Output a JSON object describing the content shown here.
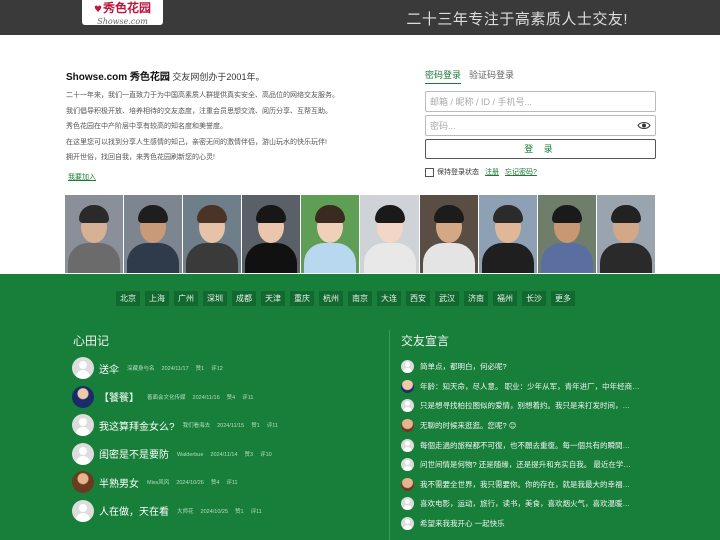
{
  "header": {
    "logo_main": "秀色花园",
    "logo_sub": "Showse.com",
    "slogan": "二十三年专注于高素质人士交友!"
  },
  "intro": {
    "brand": "Showse.com 秀色花园",
    "founded": "交友网创办于2001年。",
    "lines": [
      "二十一年来，我们一直致力于为中国高素质人群提供真实安全、高品位的网络交友服务。",
      "我们倡导积极开放、培养相待的交友态度，注重会员思想交流、阅历分享、互帮互助。",
      "秀色花园在中产阶层中享有较高的知名度和美誉度。",
      "在这里您可以找到分享人生感情的知己，亲密无间的激情伴侣，游山玩水的快乐玩伴!",
      "拥开世俗，找回自我，来秀色花园刷新您的心灵!"
    ],
    "join_link": "我要加入"
  },
  "login": {
    "tab_password": "密码登录",
    "tab_code": "验证码登录",
    "account_placeholder": "邮箱 / 昵称 / ID / 手机号...",
    "password_placeholder": "密码...",
    "submit_label": "登 录",
    "remember_label": "保持登录状态",
    "register_link": "注册",
    "forgot_link": "忘记密码?"
  },
  "photos": [
    {
      "bg": "#8a8f99",
      "skin": "#d6b196",
      "hair": "#2a2a2a",
      "body": "#6b6b6b"
    },
    {
      "bg": "#7c8590",
      "skin": "#c89a7a",
      "hair": "#1e1e1e",
      "body": "#2f3b4a"
    },
    {
      "bg": "#6e7f8a",
      "skin": "#e6c2a8",
      "hair": "#4a3428",
      "body": "#3a3a3a"
    },
    {
      "bg": "#5a5f68",
      "skin": "#e9c6ad",
      "hair": "#171717",
      "body": "#111111"
    },
    {
      "bg": "#5f9f55",
      "skin": "#f0d0b8",
      "hair": "#3a2a20",
      "body": "#b8d8f0"
    },
    {
      "bg": "#cfd3d8",
      "skin": "#f2d6c6",
      "hair": "#1a1a1a",
      "body": "#e8e8e8"
    },
    {
      "bg": "#5a4e44",
      "skin": "#d4a884",
      "hair": "#1c1c1c",
      "body": "#e4e4e4"
    },
    {
      "bg": "#8da0b4",
      "skin": "#e0b898",
      "hair": "#2b2b2b",
      "body": "#1f1f1f"
    },
    {
      "bg": "#6f7e6a",
      "skin": "#c89874",
      "hair": "#1a1a1a",
      "body": "#5a6fa0"
    },
    {
      "bg": "#9aa4ae",
      "skin": "#d2a888",
      "hair": "#222222",
      "body": "#2a2a2a"
    }
  ],
  "cities": [
    "北京",
    "上海",
    "广州",
    "深圳",
    "成都",
    "天津",
    "重庆",
    "杭州",
    "南京",
    "大连",
    "西安",
    "武汉",
    "济南",
    "福州",
    "长沙",
    "更多"
  ],
  "diary": {
    "title": "心田记",
    "items": [
      {
        "avatar": "generic",
        "text": "送伞",
        "author": "深藏身与名",
        "date": "2024/11/17",
        "likes": "赞1",
        "comments": "评12"
      },
      {
        "avatar": "photo1",
        "text": "【饕餮】",
        "author": "善面会文化传媒",
        "date": "2024/11/16",
        "likes": "赞4",
        "comments": "评11"
      },
      {
        "avatar": "generic",
        "text": "我这算拜金女么?",
        "author": "我们看海去",
        "date": "2024/11/15",
        "likes": "赞1",
        "comments": "评11"
      },
      {
        "avatar": "generic",
        "text": "闺密是不是要防",
        "author": "Walderbue",
        "date": "2024/11/14",
        "likes": "赞3",
        "comments": "评10"
      },
      {
        "avatar": "photo2",
        "text": "半熟男女",
        "author": "Miss风风",
        "date": "2024/10/26",
        "likes": "赞4",
        "comments": "评11"
      },
      {
        "avatar": "generic",
        "text": "人在做，天在看",
        "author": "大师花",
        "date": "2024/10/25",
        "likes": "赞1",
        "comments": "评11"
      }
    ]
  },
  "declarations": {
    "title": "交友宣言",
    "items": [
      {
        "avatar": "generic",
        "text": "简单点，都明白，何必呢?"
      },
      {
        "avatar": "photo1",
        "text": "年龄：知天命，尽人意。 职业：少年从军，青年进厂，中年经商…"
      },
      {
        "avatar": "generic",
        "text": "只是想寻找柏拉图似的爱情，别想着约。我只是来打发时间，…"
      },
      {
        "avatar": "photo2",
        "text": "无聊的时候来逛逛。您呢? 😊"
      },
      {
        "avatar": "generic",
        "text": "每個走過的旅程都不可復，也不願去重復。每一個共有的瞬間…"
      },
      {
        "avatar": "generic",
        "text": "问世间情是何物? 还是随缘，还是提升和充实自我。 最近在学…"
      },
      {
        "avatar": "photo2",
        "text": "我不需要全世界，我只需要你。你的存在，就是我最大的幸福…"
      },
      {
        "avatar": "generic",
        "text": "喜欢电影，运动，旅行，读书，美食，喜欢烟火气，喜欢温暖…"
      },
      {
        "avatar": "generic",
        "text": "希望来我我开心 一起快乐"
      }
    ]
  },
  "colors": {
    "header_bg": "#3a3a3a",
    "brand_green": "#177f39",
    "logo_red": "#c0143c"
  }
}
